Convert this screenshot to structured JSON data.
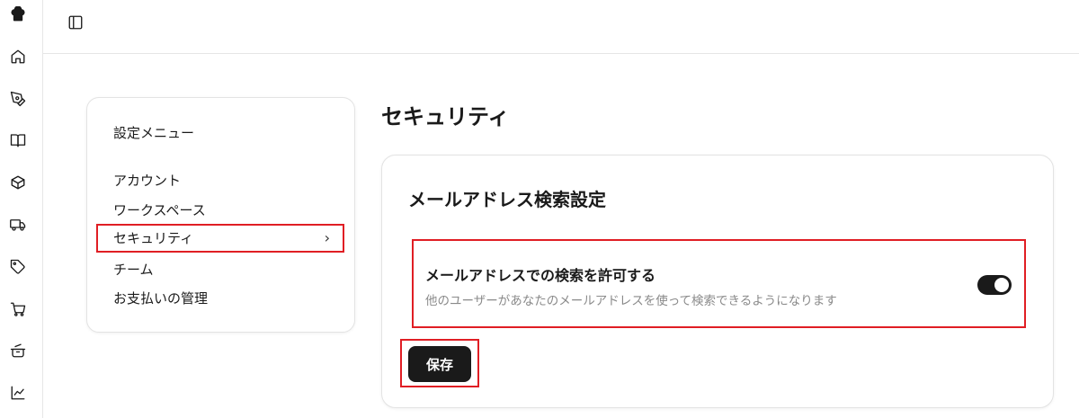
{
  "rail": {
    "icons": [
      "chef-hat-icon",
      "home-icon",
      "pen-icon",
      "book-icon",
      "package-icon",
      "truck-icon",
      "tag-icon",
      "cart-icon",
      "pot-icon",
      "chart-icon"
    ]
  },
  "settings_menu": {
    "title": "設定メニュー",
    "items": [
      {
        "label": "アカウント"
      },
      {
        "label": "ワークスペース"
      },
      {
        "label": "セキュリティ",
        "active": true
      },
      {
        "label": "チーム"
      },
      {
        "label": "お支払いの管理"
      }
    ]
  },
  "page": {
    "title": "セキュリティ"
  },
  "email_search": {
    "section_title": "メールアドレス検索設定",
    "setting_label": "メールアドレスでの検索を許可する",
    "setting_description": "他のユーザーがあなたのメールアドレスを使って検索できるようになります",
    "enabled": true
  },
  "actions": {
    "save_label": "保存"
  }
}
